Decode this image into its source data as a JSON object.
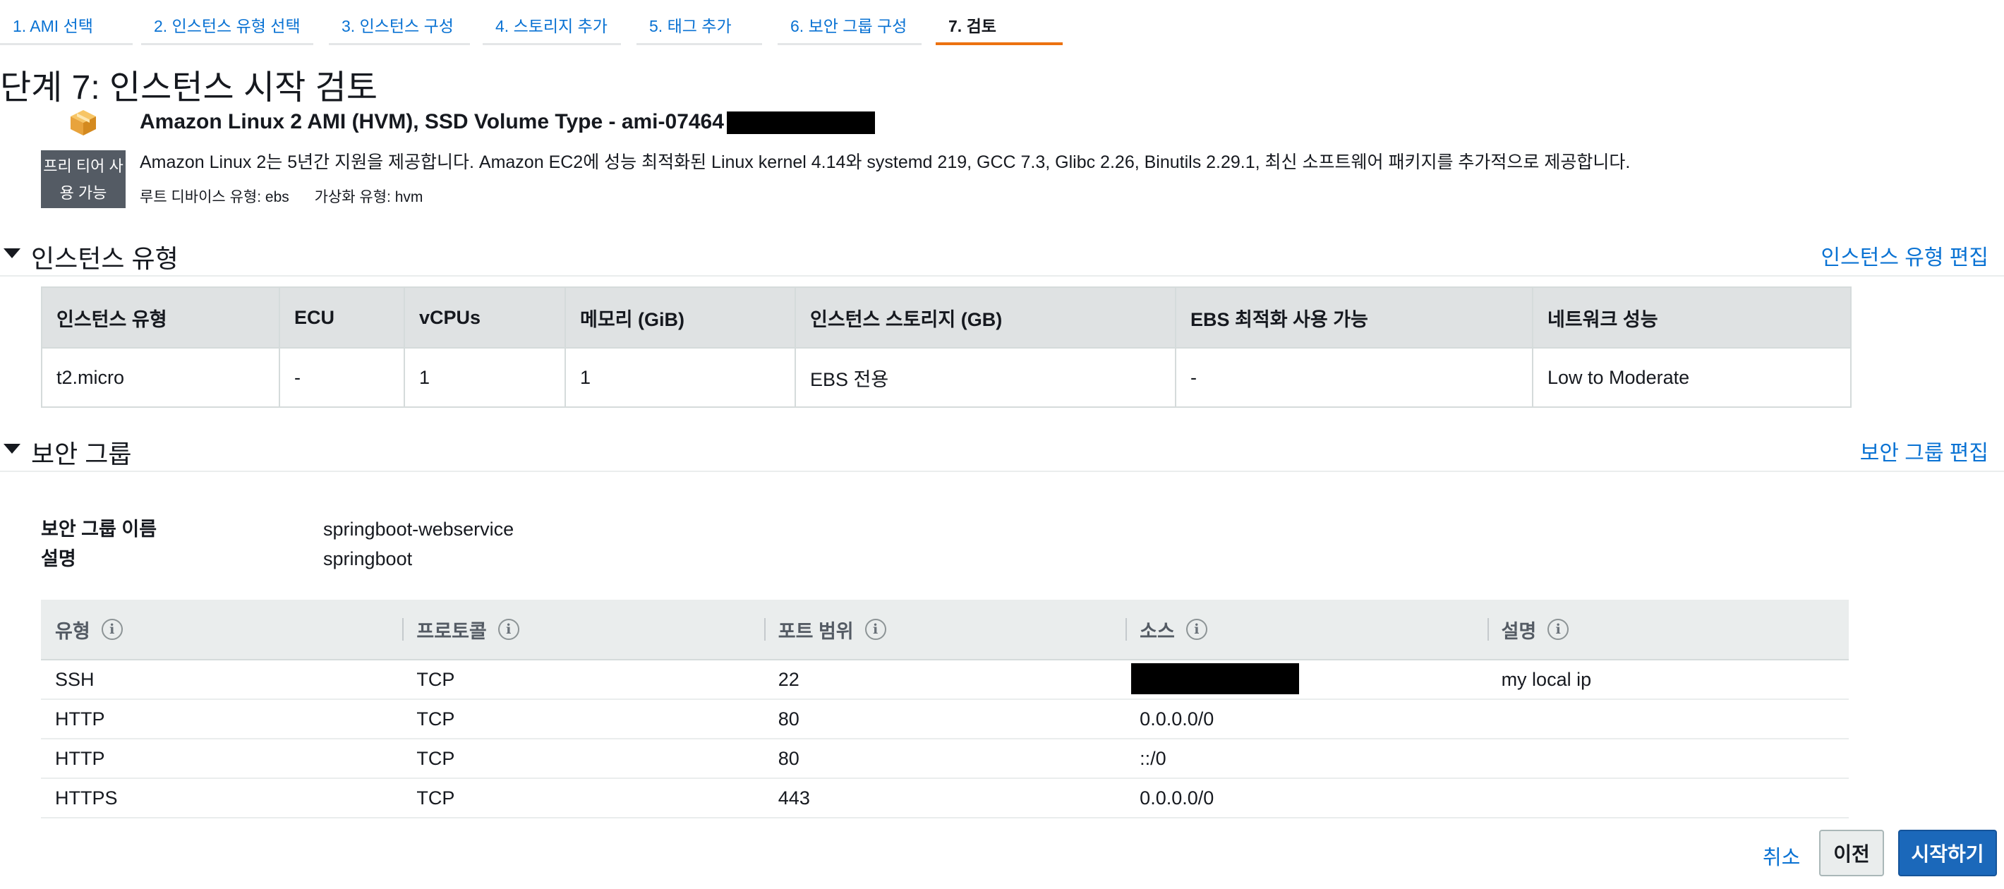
{
  "wizard": {
    "steps": [
      {
        "label": "1. AMI 선택"
      },
      {
        "label": "2. 인스턴스 유형 선택"
      },
      {
        "label": "3. 인스턴스 구성"
      },
      {
        "label": "4. 스토리지 추가"
      },
      {
        "label": "5. 태그 추가"
      },
      {
        "label": "6. 보안 그룹 구성"
      },
      {
        "label": "7. 검토"
      }
    ],
    "active_step": "7. 검토"
  },
  "page": {
    "title": "단계 7: 인스턴스 시작 검토"
  },
  "ami": {
    "icon": "package-cube-icon",
    "title": "Amazon Linux 2 AMI (HVM), SSD Volume Type - ami-07464",
    "free_tier_line1": "프리 티어 사",
    "free_tier_line2": "용 가능",
    "description": "Amazon Linux 2는 5년간 지원을 제공합니다. Amazon EC2에 성능 최적화된 Linux kernel 4.14와 systemd 219, GCC 7.3, Glibc 2.26, Binutils 2.29.1, 최신 소프트웨어 패키지를 추가적으로 제공합니다.",
    "root_device": "루트 디바이스 유형: ebs",
    "virtualization": "가상화 유형: hvm"
  },
  "instance_section": {
    "title": "인스턴스 유형",
    "edit_link": "인스턴스 유형 편집",
    "headers": [
      "인스턴스 유형",
      "ECU",
      "vCPUs",
      "메모리 (GiB)",
      "인스턴스 스토리지 (GB)",
      "EBS 최적화 사용 가능",
      "네트워크 성능"
    ],
    "row": [
      "t2.micro",
      "-",
      "1",
      "1",
      "EBS 전용",
      "-",
      "Low to Moderate"
    ]
  },
  "security_section": {
    "title": "보안 그룹",
    "edit_link": "보안 그룹 편집",
    "name_label": "보안 그룹 이름",
    "name_value": "springboot-webservice",
    "desc_label": "설명",
    "desc_value": "springboot",
    "headers": [
      "유형",
      "프로토콜",
      "포트 범위",
      "소스",
      "설명"
    ],
    "rows": [
      [
        "SSH",
        "TCP",
        "22",
        "",
        "my local ip"
      ],
      [
        "HTTP",
        "TCP",
        "80",
        "0.0.0.0/0",
        ""
      ],
      [
        "HTTP",
        "TCP",
        "80",
        "::/0",
        ""
      ],
      [
        "HTTPS",
        "TCP",
        "443",
        "0.0.0.0/0",
        ""
      ]
    ]
  },
  "footer": {
    "cancel": "취소",
    "previous": "이전",
    "launch": "시작하기"
  },
  "colors": {
    "link": "#0972d3",
    "active_tab": "#ec7211",
    "primary_button": "#1b68ba",
    "badge": "#545b64"
  }
}
